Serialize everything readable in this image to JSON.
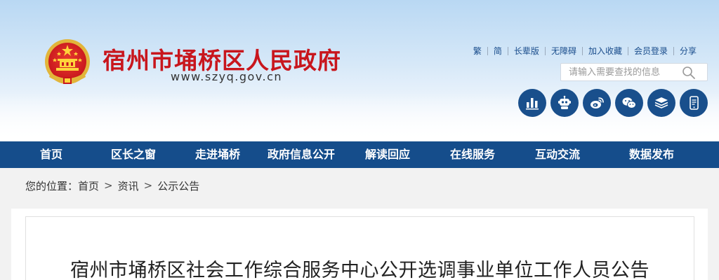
{
  "header": {
    "site_title": "宿州市埇桥区人民政府",
    "site_url": "www.szyq.gov.cn",
    "top_links": [
      "繁",
      "简",
      "长辈版",
      "无障碍",
      "加入收藏",
      "会员登录",
      "分享"
    ],
    "search_placeholder": "请输入需要查找的信息",
    "circle_icons": [
      "chart-icon",
      "robot-icon",
      "weibo-icon",
      "wechat-icon",
      "layers-icon",
      "mobile-icon"
    ]
  },
  "nav": {
    "items": [
      "首页",
      "区长之窗",
      "走进埇桥",
      "政府信息公开",
      "解读回应",
      "在线服务",
      "互动交流",
      "数据发布"
    ]
  },
  "breadcrumb": {
    "label": "您的位置：",
    "items": [
      "首页",
      "资讯",
      "公示公告"
    ],
    "separator": ">"
  },
  "article": {
    "title": "宿州市埇桥区社会工作综合服务中心公开选调事业单位工作人员公告"
  },
  "colors": {
    "brand_red": "#c8161d",
    "nav_blue": "#154d8b",
    "icon_blue": "#194f8c",
    "link_blue": "#1a4d8c"
  }
}
